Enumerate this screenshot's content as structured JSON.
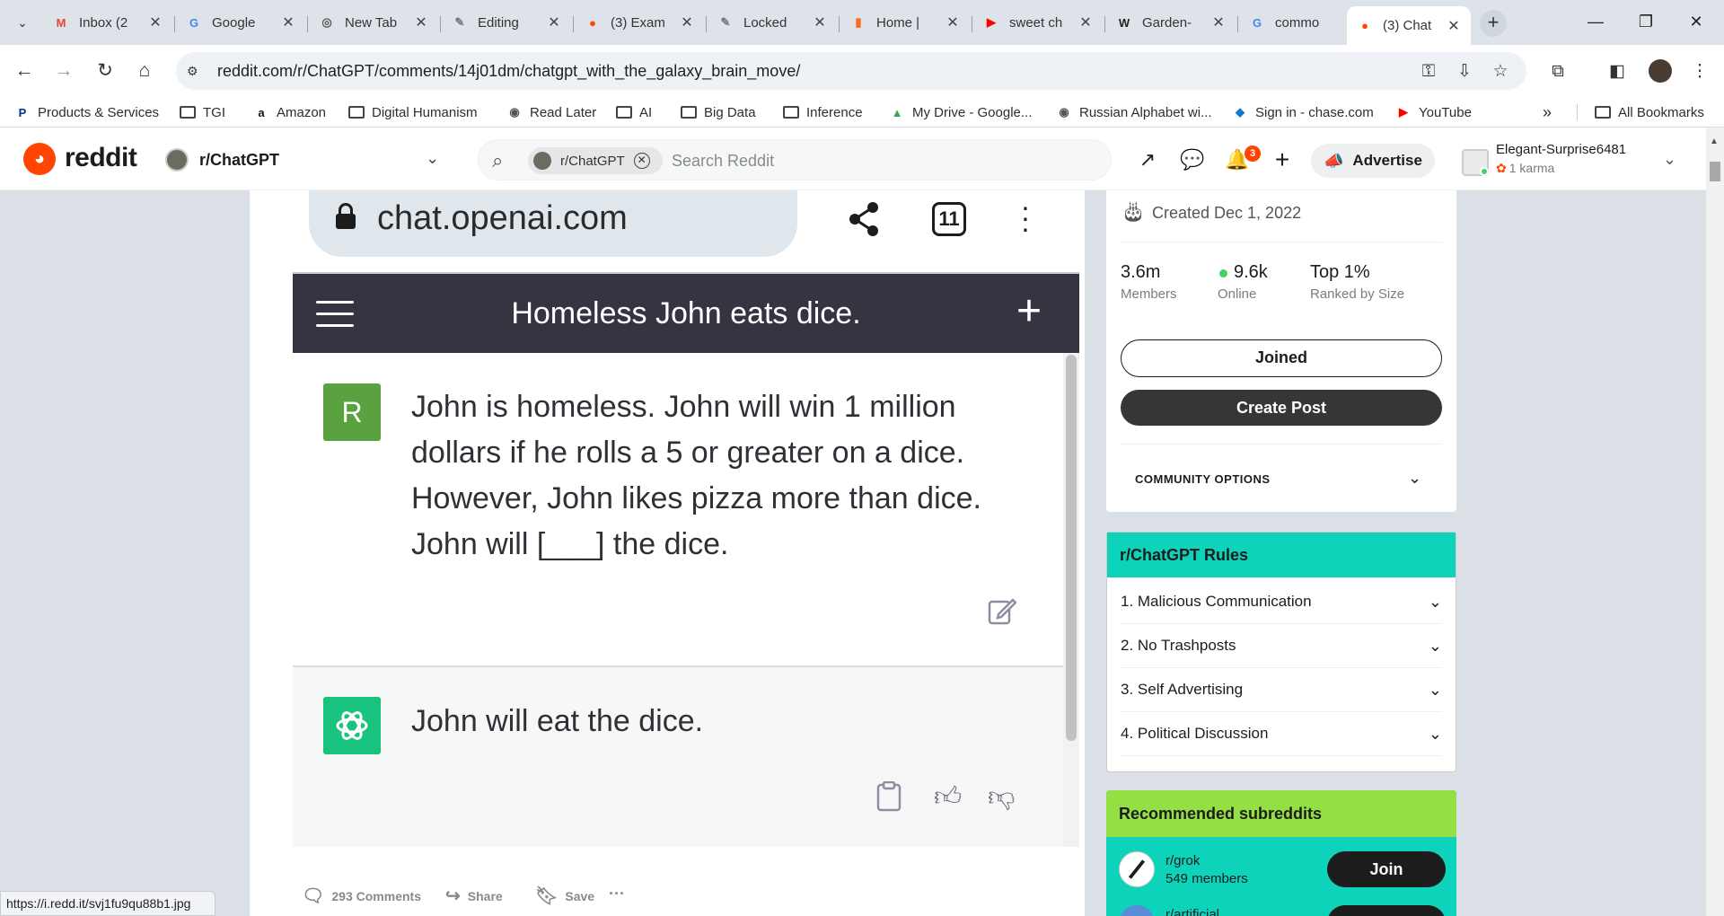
{
  "browser": {
    "tabs": [
      {
        "label": "Inbox (2",
        "icon": "gmail-icon",
        "glyph": "M",
        "color": "#ea4335"
      },
      {
        "label": "Google",
        "icon": "google-icon",
        "glyph": "G",
        "color": "#4285f4"
      },
      {
        "label": "New Tab",
        "icon": "chrome-icon",
        "glyph": "◎",
        "color": "#555555"
      },
      {
        "label": "Editing",
        "icon": "editor-icon",
        "glyph": "✎",
        "color": "#777777"
      },
      {
        "label": "(3) Exam",
        "icon": "reddit-icon",
        "glyph": "●",
        "color": "#ff4500"
      },
      {
        "label": "Locked",
        "icon": "editor-icon",
        "glyph": "✎",
        "color": "#777777"
      },
      {
        "label": "Home |",
        "icon": "bookmark-site-icon",
        "glyph": "▮",
        "color": "#ff6719"
      },
      {
        "label": "sweet ch",
        "icon": "youtube-icon",
        "glyph": "▶",
        "color": "#ff0000"
      },
      {
        "label": "Garden-",
        "icon": "wikipedia-icon",
        "glyph": "W",
        "color": "#222222"
      },
      {
        "label": "commo",
        "icon": "google-icon",
        "glyph": "G",
        "color": "#4285f4"
      },
      {
        "label": "(3) Chat",
        "icon": "reddit-icon",
        "glyph": "●",
        "color": "#ff4500",
        "active": true
      }
    ],
    "address": "reddit.com/r/ChatGPT/comments/14j01dm/chatgpt_with_the_galaxy_brain_move/",
    "bookmarks": [
      {
        "label": "Products & Services",
        "icon": "paypal-icon"
      },
      {
        "label": "TGI",
        "icon": "folder-icon"
      },
      {
        "label": "Amazon",
        "icon": "amazon-icon"
      },
      {
        "label": "Digital Humanism",
        "icon": "folder-icon"
      },
      {
        "label": "Read Later",
        "icon": "globe-icon"
      },
      {
        "label": "AI",
        "icon": "folder-icon"
      },
      {
        "label": "Big Data",
        "icon": "folder-icon"
      },
      {
        "label": "Inference",
        "icon": "folder-icon"
      },
      {
        "label": "My Drive - Google...",
        "icon": "drive-icon"
      },
      {
        "label": "Russian Alphabet wi...",
        "icon": "globe-icon"
      },
      {
        "label": "Sign in - chase.com",
        "icon": "chase-icon"
      },
      {
        "label": "YouTube",
        "icon": "youtube-icon"
      }
    ],
    "all_bookmarks": "All Bookmarks",
    "more_bookmarks": "»",
    "status_url": "https://i.redd.it/svj1fu9qu88b1.jpg"
  },
  "reddit_header": {
    "wordmark": "reddit",
    "subreddit": "r/ChatGPT",
    "search_chip": "r/ChatGPT",
    "search_placeholder": "Search Reddit",
    "notification_count": "3",
    "advertise": "Advertise",
    "username": "Elegant-Surprise6481",
    "karma": "1 karma"
  },
  "post_image": {
    "url": "chat.openai.com",
    "tab_count": "11",
    "chat_title": "Homeless John eats dice.",
    "user_avatar": "R",
    "user_message": "John is homeless. John will win 1 million dollars if he rolls a 5 or greater on a dice. However, John likes pizza more than dice. John will [___] the dice.",
    "ai_message": "John will eat the dice."
  },
  "post_actions": {
    "comments": "293 Comments",
    "share": "Share",
    "save": "Save",
    "more": "···"
  },
  "sidebar": {
    "created": "Created Dec 1, 2022",
    "stats": [
      {
        "value": "3.6m",
        "label": "Members"
      },
      {
        "value": "9.6k",
        "label": "Online"
      },
      {
        "value": "Top 1%",
        "label": "Ranked by Size"
      }
    ],
    "joined": "Joined",
    "create_post": "Create Post",
    "community_options": "COMMUNITY OPTIONS",
    "rules_title": "r/ChatGPT Rules",
    "rules": [
      "1. Malicious Communication",
      "2. No Trashposts",
      "3. Self Advertising",
      "4. Political Discussion"
    ],
    "recommended_title": "Recommended subreddits",
    "recommended": [
      {
        "name": "r/grok",
        "members": "549 members",
        "join": "Join"
      },
      {
        "name": "r/artificial",
        "members": "",
        "join": ""
      }
    ]
  }
}
